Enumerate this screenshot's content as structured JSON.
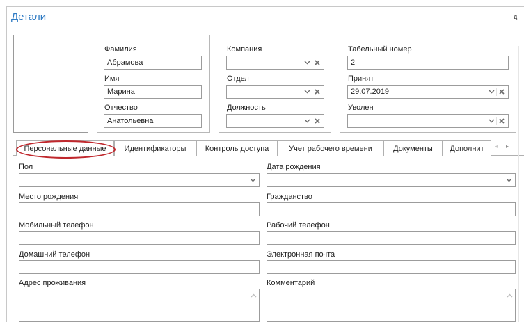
{
  "header": {
    "title": "Детали",
    "corner_text": "д"
  },
  "profile": {
    "last_name": {
      "label": "Фамилия",
      "value": "Абрамова"
    },
    "first_name": {
      "label": "Имя",
      "value": "Марина"
    },
    "middle_name": {
      "label": "Отчество",
      "value": "Анатольевна"
    }
  },
  "org": {
    "company": {
      "label": "Компания",
      "value": ""
    },
    "department": {
      "label": "Отдел",
      "value": ""
    },
    "position": {
      "label": "Должность",
      "value": ""
    }
  },
  "employment": {
    "employee_number": {
      "label": "Табельный номер",
      "value": "2"
    },
    "hired": {
      "label": "Принят",
      "value": "29.07.2019"
    },
    "dismissed": {
      "label": "Уволен",
      "value": ""
    }
  },
  "tabs": [
    {
      "label": "Персональные данные"
    },
    {
      "label": "Идентификаторы"
    },
    {
      "label": "Контроль доступа"
    },
    {
      "label": "Учет рабочего времени"
    },
    {
      "label": "Документы"
    },
    {
      "label": "Дополнит"
    }
  ],
  "tab_scroll": {
    "left": "◂",
    "right": "▸"
  },
  "personal": {
    "gender": {
      "label": "Пол",
      "value": ""
    },
    "birth_date": {
      "label": "Дата рождения",
      "value": ""
    },
    "birth_place": {
      "label": "Место рождения",
      "value": ""
    },
    "citizenship": {
      "label": "Гражданство",
      "value": ""
    },
    "mobile_phone": {
      "label": "Мобильный телефон",
      "value": ""
    },
    "work_phone": {
      "label": "Рабочий телефон",
      "value": ""
    },
    "home_phone": {
      "label": "Домашний телефон",
      "value": ""
    },
    "email": {
      "label": "Электронная почта",
      "value": ""
    },
    "address": {
      "label": "Адрес проживания",
      "value": ""
    },
    "comment": {
      "label": "Комментарий",
      "value": ""
    }
  },
  "icons": {
    "dropdown": "chevron-down-icon",
    "clear": "close-icon",
    "scroll_up": "chevron-up-icon"
  },
  "colors": {
    "title": "#2f7bc4",
    "highlight": "#c0282d"
  }
}
